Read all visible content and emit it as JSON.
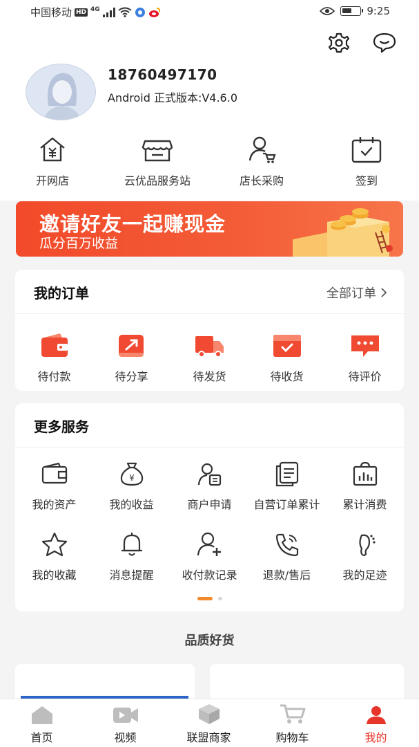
{
  "status_bar": {
    "carrier": "中国移动",
    "hd_badge": "HD",
    "network": "4G",
    "time": "9:25",
    "battery_level": 0.55
  },
  "header": {
    "settings_icon": "gear-icon",
    "message_icon": "chat-bubble-icon"
  },
  "profile": {
    "phone": "18760497170",
    "version": "Android 正式版本:V4.6.0"
  },
  "quick_actions": [
    {
      "label": "开网店",
      "icon": "shop-house-icon"
    },
    {
      "label": "云优品服务站",
      "icon": "storefront-icon"
    },
    {
      "label": "店长采购",
      "icon": "person-cart-icon"
    },
    {
      "label": "签到",
      "icon": "calendar-check-icon"
    }
  ],
  "banner": {
    "title": "邀请好友一起赚现金",
    "subtitle": "瓜分百万收益"
  },
  "orders": {
    "title": "我的订单",
    "all_link": "全部订单",
    "items": [
      {
        "label": "待付款",
        "icon": "wallet-icon"
      },
      {
        "label": "待分享",
        "icon": "share-icon"
      },
      {
        "label": "待发货",
        "icon": "truck-icon"
      },
      {
        "label": "待收货",
        "icon": "box-check-icon"
      },
      {
        "label": "待评价",
        "icon": "comment-icon"
      }
    ]
  },
  "services": {
    "title": "更多服务",
    "items": [
      {
        "label": "我的资产",
        "icon": "wallet-outline-icon"
      },
      {
        "label": "我的收益",
        "icon": "money-bag-icon"
      },
      {
        "label": "商户申请",
        "icon": "merchant-apply-icon"
      },
      {
        "label": "自营订单累计",
        "icon": "documents-icon"
      },
      {
        "label": "累计消费",
        "icon": "bar-chart-bag-icon"
      },
      {
        "label": "我的收藏",
        "icon": "star-icon"
      },
      {
        "label": "消息提醒",
        "icon": "bell-icon"
      },
      {
        "label": "收付款记录",
        "icon": "person-add-icon"
      },
      {
        "label": "退款/售后",
        "icon": "phone-call-icon"
      },
      {
        "label": "我的足迹",
        "icon": "footprint-icon"
      }
    ]
  },
  "section": {
    "title": "品质好货"
  },
  "tabbar": {
    "tabs": [
      {
        "label": "首页",
        "icon": "home-icon"
      },
      {
        "label": "视频",
        "icon": "video-icon"
      },
      {
        "label": "联盟商家",
        "icon": "cube-icon"
      },
      {
        "label": "购物车",
        "icon": "cart-icon"
      },
      {
        "label": "我的",
        "icon": "profile-icon"
      }
    ],
    "active_index": 4
  },
  "colors": {
    "accent_red": "#e8352b",
    "banner_orange": "#f24a2a",
    "dot_orange": "#f38b2d"
  }
}
